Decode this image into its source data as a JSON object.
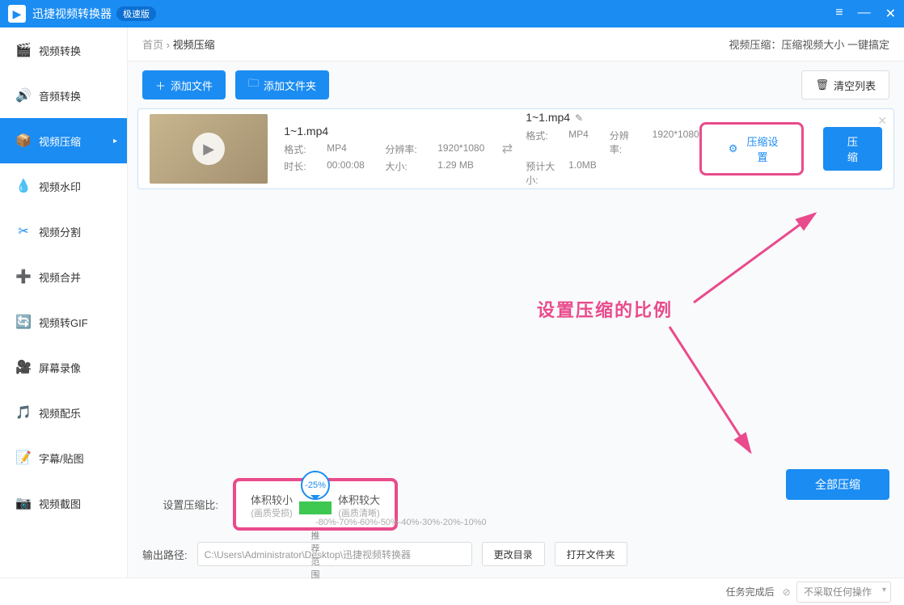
{
  "titlebar": {
    "app_name": "迅捷视频转换器",
    "badge": "极速版"
  },
  "sidebar": {
    "items": [
      {
        "label": "视频转换",
        "icon": "🎬"
      },
      {
        "label": "音频转换",
        "icon": "🔊"
      },
      {
        "label": "视频压缩",
        "icon": "📦"
      },
      {
        "label": "视频水印",
        "icon": "💧"
      },
      {
        "label": "视频分割",
        "icon": "✂"
      },
      {
        "label": "视频合并",
        "icon": "➕"
      },
      {
        "label": "视频转GIF",
        "icon": "🔄"
      },
      {
        "label": "屏幕录像",
        "icon": "🎥"
      },
      {
        "label": "视频配乐",
        "icon": "🎵"
      },
      {
        "label": "字幕/贴图",
        "icon": "📝"
      },
      {
        "label": "视频截图",
        "icon": "📷"
      }
    ]
  },
  "breadcrumb": {
    "home": "首页",
    "current": "视频压缩"
  },
  "subtitle": "视频压缩：压缩视频大小 一键搞定",
  "toolbar": {
    "add_file": "添加文件",
    "add_folder": "添加文件夹",
    "clear": "清空列表"
  },
  "file": {
    "in_name": "1~1.mp4",
    "format_lbl": "格式:",
    "format": "MP4",
    "res_lbl": "分辨率:",
    "resolution": "1920*1080",
    "dur_lbl": "时长:",
    "duration": "00:00:08",
    "size_lbl": "大小:",
    "size": "1.29 MB",
    "out_name": "1~1.mp4",
    "out_format_lbl": "格式:",
    "out_format": "MP4",
    "out_res_lbl": "分辨率:",
    "out_resolution": "1920*1080",
    "est_lbl": "预计大小:",
    "est_size": "1.0MB",
    "settings_btn": "压缩设置",
    "compress_btn": "压缩"
  },
  "annotation": "设置压缩的比例",
  "slider": {
    "label": "设置压缩比:",
    "left": "体积较小",
    "left_sub": "(画质受损)",
    "right": "体积较大",
    "right_sub": "(画质清晰)",
    "value": "-25%",
    "rec": "推荐范围",
    "ticks": [
      "-80%",
      "-70%",
      "-60%",
      "-50%",
      "-40%",
      "-30%",
      "-20%",
      "-10%",
      "0"
    ]
  },
  "compress_all": "全部压缩",
  "outpath": {
    "lbl": "输出路径:",
    "value": "C:\\Users\\Administrator\\Desktop\\迅捷视频转换器",
    "change": "更改目录",
    "open": "打开文件夹"
  },
  "footer": {
    "task_done": "任务完成后",
    "action": "不采取任何操作"
  }
}
